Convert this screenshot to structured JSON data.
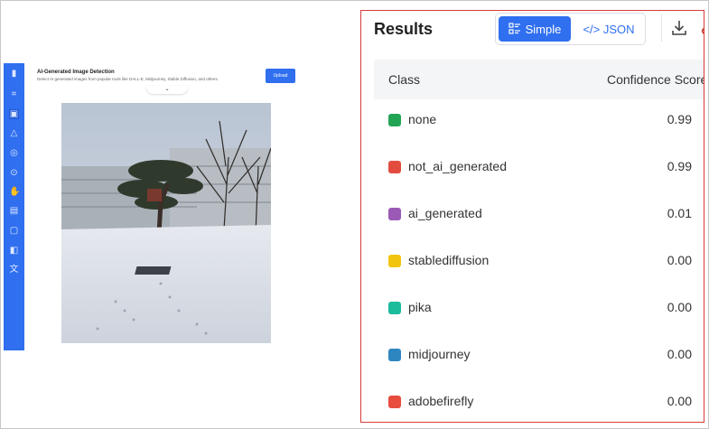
{
  "thumbnail": {
    "title": "AI-Generated Image Detection",
    "subtitle": "Detect AI generated images from popular tools like DALL-E, Midjourney, Stable Diffusion, and others.",
    "upload_label": "Upload",
    "chevron": "⌄",
    "sidebar_icons": [
      "logo-icon",
      "scan-icon",
      "image-icon",
      "shapes-icon",
      "target-icon",
      "search-icon",
      "hand-icon",
      "id-card-icon",
      "document-icon",
      "chat-icon",
      "translate-icon"
    ],
    "accent": "#2f6ff0"
  },
  "results": {
    "title": "Results",
    "toggle": {
      "simple_label": "Simple",
      "json_label": "</> JSON",
      "active": "Simple"
    },
    "columns": {
      "class": "Class",
      "score": "Confidence Score"
    },
    "rows": [
      {
        "label": "none",
        "score": "0.99",
        "color": "#22a455"
      },
      {
        "label": "not_ai_generated",
        "score": "0.99",
        "color": "#e24c3f"
      },
      {
        "label": "ai_generated",
        "score": "0.01",
        "color": "#9b59b6"
      },
      {
        "label": "stablediffusion",
        "score": "0.00",
        "color": "#f1c40f"
      },
      {
        "label": "pika",
        "score": "0.00",
        "color": "#1abc9c"
      },
      {
        "label": "midjourney",
        "score": "0.00",
        "color": "#2e86c1"
      },
      {
        "label": "adobefirefly",
        "score": "0.00",
        "color": "#e74c3c"
      }
    ]
  }
}
